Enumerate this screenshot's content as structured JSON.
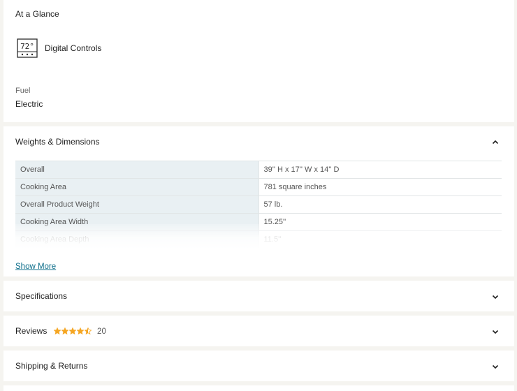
{
  "glance": {
    "title": "At a Glance",
    "feature_icon": "digital-display-icon",
    "feature_icon_text": "72°",
    "feature_label": "Digital Controls",
    "fuel_label": "Fuel",
    "fuel_value": "Electric"
  },
  "weights_dimensions": {
    "title": "Weights & Dimensions",
    "expanded": true,
    "rows": [
      {
        "label": "Overall",
        "value": "39'' H x 17'' W x 14'' D"
      },
      {
        "label": "Cooking Area",
        "value": "781 square inches"
      },
      {
        "label": "Overall Product Weight",
        "value": "57 lb."
      },
      {
        "label": "Cooking Area Width",
        "value": "15.25''"
      },
      {
        "label": "Cooking Area Depth",
        "value": "11.5''"
      }
    ],
    "show_more_label": "Show More"
  },
  "specifications": {
    "title": "Specifications"
  },
  "reviews": {
    "title": "Reviews",
    "rating": 4.5,
    "rating_max": 5,
    "count": "20",
    "star_color": "#f5a623"
  },
  "shipping": {
    "title": "Shipping & Returns"
  },
  "colors": {
    "link": "#0d6e8a",
    "table_key_bg": "#e9f0f3",
    "page_bg": "#f5f4f0"
  }
}
